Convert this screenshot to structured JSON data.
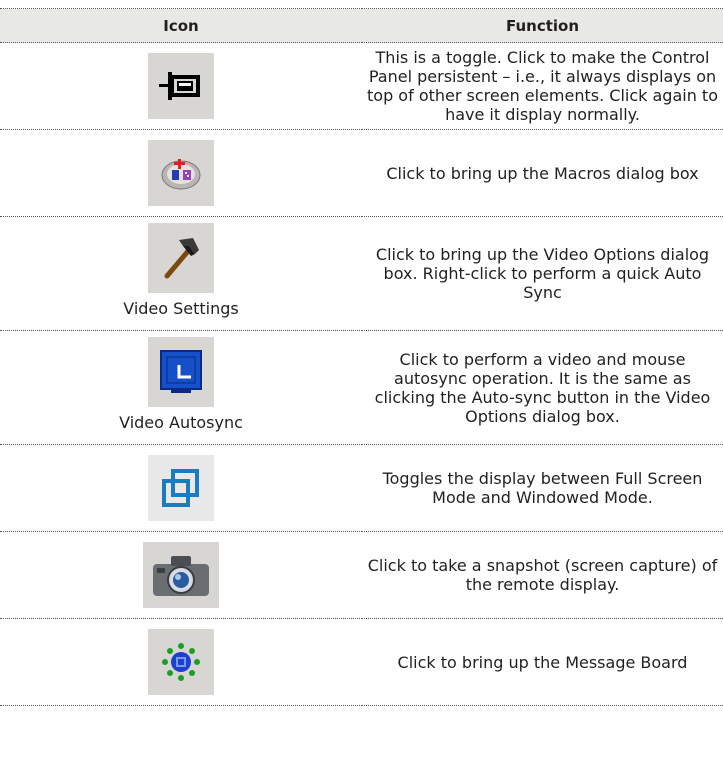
{
  "table": {
    "headers": {
      "icon": "Icon",
      "function": "Function"
    },
    "rows": [
      {
        "icon": "pin-icon",
        "caption": "",
        "function": "This is a toggle. Click to make the Control Panel persistent – i.e., it always displays on top of other screen elements. Click again to  have it display normally."
      },
      {
        "icon": "macros-icon",
        "caption": "",
        "function": "Click to bring up the Macros dialog box"
      },
      {
        "icon": "hammer-icon",
        "caption": "Video Settings",
        "function": "Click to bring up the Video Options dialog box. Right-click to perform  a quick Auto Sync"
      },
      {
        "icon": "autosync-icon",
        "caption": "Video Autosync",
        "function": "Click to perform a video and mouse autosync operation. It is the  same as clicking the Auto-sync button in the Video Options dialog box."
      },
      {
        "icon": "window-toggle-icon",
        "caption": "",
        "function": "Toggles the display between Full Screen Mode and Windowed Mode."
      },
      {
        "icon": "camera-icon",
        "caption": "",
        "function": "Click to take a snapshot (screen capture) of the remote display."
      },
      {
        "icon": "message-board-icon",
        "caption": "",
        "function": "Click to bring up the Message Board"
      }
    ]
  }
}
